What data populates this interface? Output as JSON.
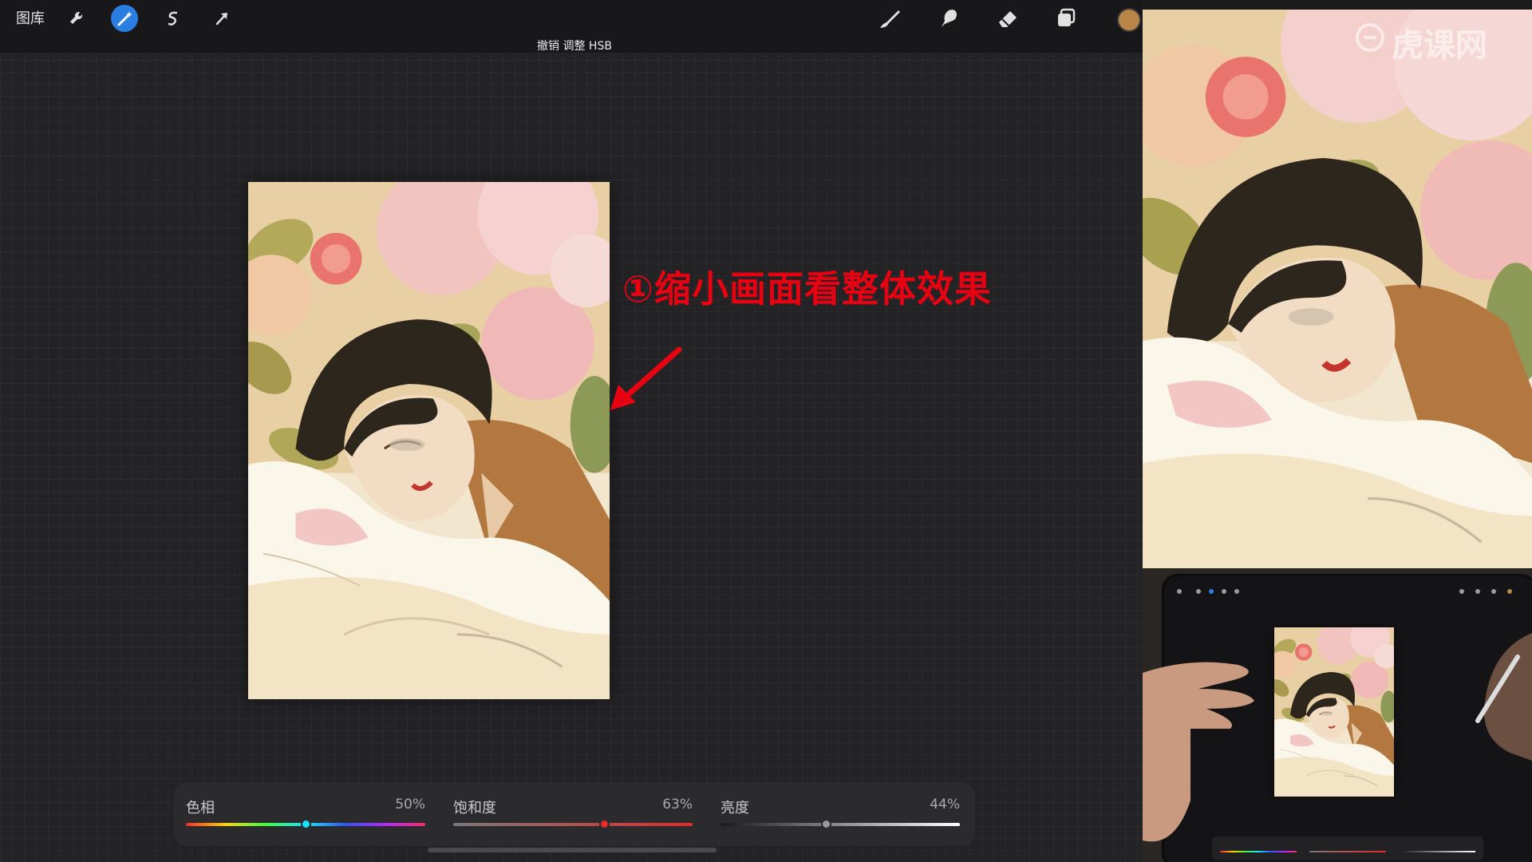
{
  "app": {
    "gallery_label": "图库",
    "undo_banner": "撤销 调整 HSB",
    "icons": {
      "wrench": "wrench-icon",
      "adjustments": "magic-wand-icon",
      "selection": "selection-icon",
      "transform": "arrow-cursor-icon",
      "brush": "brush-icon",
      "smudge": "smudge-icon",
      "eraser": "eraser-icon",
      "layers": "layers-icon"
    },
    "accent_color": "#2a7de1",
    "current_color": "#b98548"
  },
  "annotation": {
    "text": "①缩小画面看整体效果",
    "color": "#e60012"
  },
  "hsb": {
    "hue": {
      "label": "色相",
      "value_text": "50%",
      "value": 0.5
    },
    "saturation": {
      "label": "饱和度",
      "value_text": "63%",
      "value": 0.63
    },
    "brightness": {
      "label": "亮度",
      "value_text": "44%",
      "value": 0.44
    }
  },
  "watermark": {
    "text": "虎课网"
  }
}
